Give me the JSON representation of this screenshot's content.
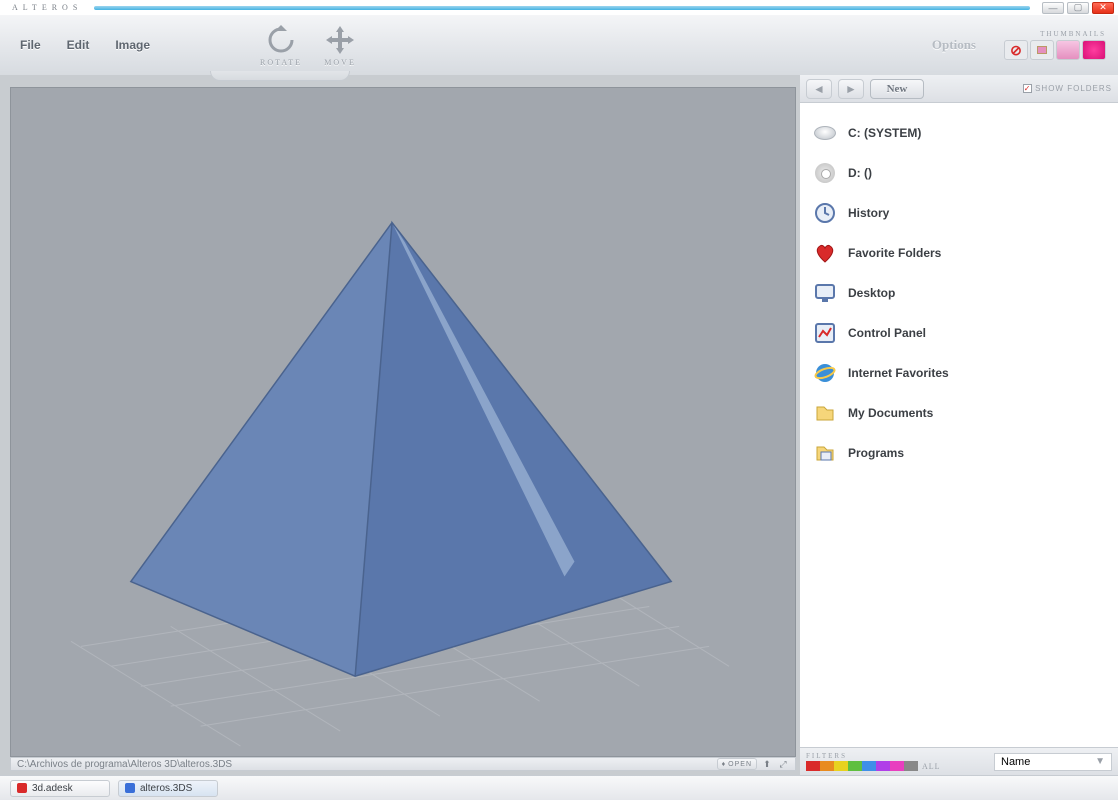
{
  "app": {
    "title": "ALTEROS"
  },
  "menu": {
    "file": "File",
    "edit": "Edit",
    "image": "Image"
  },
  "tools": {
    "rotate": "ROTATE",
    "move": "MOVE"
  },
  "options_label": "Options",
  "thumbnails": {
    "header": "THUMBNAILS"
  },
  "sidebar": {
    "new_label": "New",
    "show_folders_label": "SHOW FOLDERS",
    "items": [
      {
        "icon": "drive",
        "label": "C: (SYSTEM)"
      },
      {
        "icon": "disc",
        "label": "D: ()"
      },
      {
        "icon": "history",
        "label": "History"
      },
      {
        "icon": "heart",
        "label": "Favorite Folders"
      },
      {
        "icon": "desktop",
        "label": "Desktop"
      },
      {
        "icon": "cpanel",
        "label": "Control Panel"
      },
      {
        "icon": "ie",
        "label": "Internet Favorites"
      },
      {
        "icon": "docs",
        "label": "My Documents"
      },
      {
        "icon": "progs",
        "label": "Programs"
      }
    ]
  },
  "status": {
    "path": "C:\\Archivos de programa\\Alteros 3D\\alteros.3DS",
    "open_label": "OPEN"
  },
  "filters": {
    "label": "FILTERS",
    "all": "ALL",
    "sort_by": "Name"
  },
  "taskbar": {
    "items": [
      {
        "label": "3d.adesk",
        "color": "#d92a2a"
      },
      {
        "label": "alteros.3DS",
        "color": "#3a6fd8"
      }
    ]
  }
}
